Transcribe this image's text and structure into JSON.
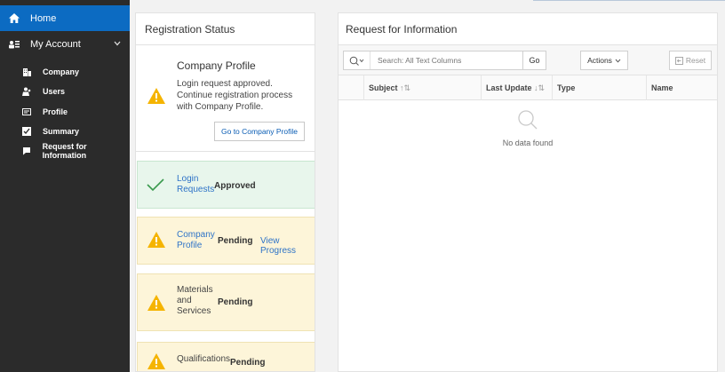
{
  "sidebar": {
    "home": "Home",
    "my_account": "My Account",
    "items": [
      {
        "label": "Company",
        "icon": "building-icon"
      },
      {
        "label": "Users",
        "icon": "users-icon"
      },
      {
        "label": "Profile",
        "icon": "id-card-icon"
      },
      {
        "label": "Summary",
        "icon": "summary-icon"
      },
      {
        "label": "Request for Information",
        "icon": "chat-icon"
      }
    ],
    "colors": {
      "active": "#0c6bc2",
      "background": "#2b2b2b"
    }
  },
  "registration": {
    "title": "Registration Status",
    "profile_card": {
      "title": "Company Profile",
      "message": "Login request approved. Continue registration process with Company Profile.",
      "button": "Go to Company Profile"
    },
    "statuses": [
      {
        "label": "Login Requests",
        "state": "Approved",
        "type": "success"
      },
      {
        "label": "Company Profile",
        "state": "Pending",
        "type": "warning",
        "link": "View Progress"
      },
      {
        "label": "Materials and Services",
        "state": "Pending",
        "type": "warning"
      },
      {
        "label": "Qualifications",
        "state": "Pending",
        "type": "warning"
      }
    ]
  },
  "rfi": {
    "title": "Request for Information",
    "search_placeholder": "Search: All Text Columns",
    "go_label": "Go",
    "actions_label": "Actions",
    "reset_label": "Reset",
    "columns": [
      "Subject",
      "Last Update",
      "Type",
      "Name"
    ],
    "empty_text": "No data found"
  }
}
